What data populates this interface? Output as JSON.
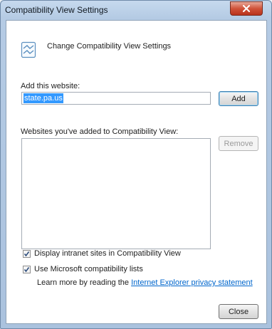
{
  "window": {
    "title": "Compatibility View Settings"
  },
  "header": {
    "title": "Change Compatibility View Settings",
    "icon": "compat-view-icon"
  },
  "add_section": {
    "label": "Add this website:",
    "input_value": "state.pa.us",
    "add_button": "Add"
  },
  "list_section": {
    "label": "Websites you've added to Compatibility View:",
    "items": [],
    "remove_button": "Remove"
  },
  "options": {
    "intranet_label": "Display intranet sites in Compatibility View",
    "intranet_checked": true,
    "ms_lists_label": "Use Microsoft compatibility lists",
    "ms_lists_checked": true
  },
  "footer": {
    "learn_prefix": "Learn more by reading the",
    "learn_link": "Internet Explorer privacy statement",
    "close_button": "Close"
  },
  "colors": {
    "selection": "#3399ff",
    "link": "#0066cc",
    "close_red": "#d0533a"
  }
}
